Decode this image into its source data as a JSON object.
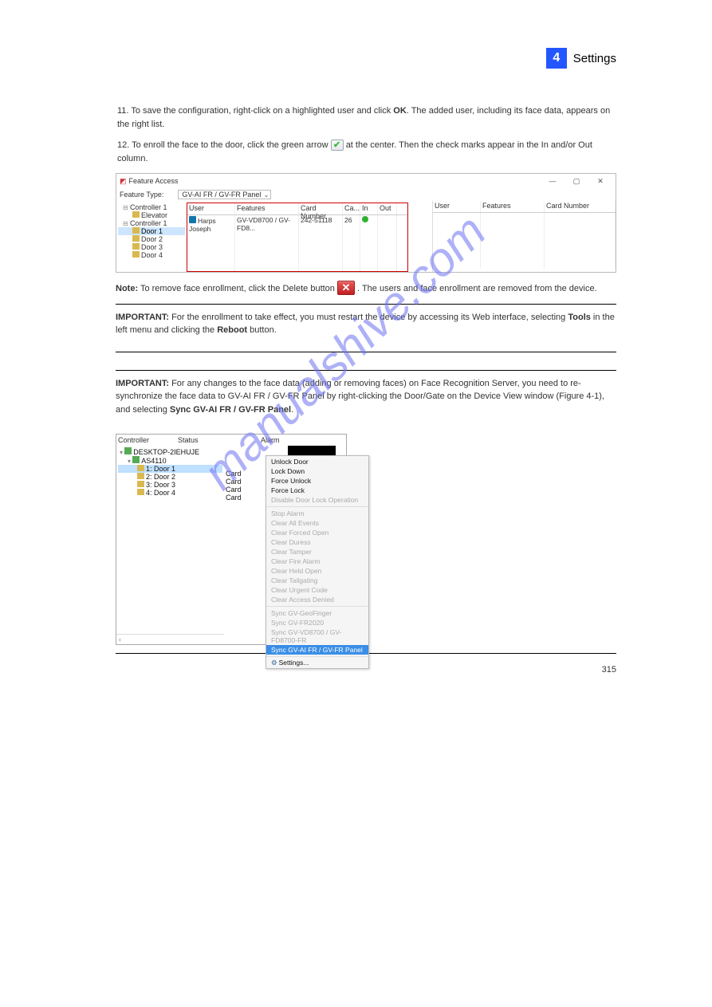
{
  "header": {
    "chapter_num": "4",
    "chapter_title": "Settings"
  },
  "step11": "11. To save the configuration, right-click on a highlighted user and click ",
  "step11_b": "OK",
  "step11_end": ". The added user, including its face data, appears on the right list.",
  "step12": "12. To enroll the face to the door, click the green arrow ",
  "step12_end": " at the center. Then the check marks appear in the In and/or Out column.",
  "note_hdr": "Note:",
  "note_txt": " To remove face enrollment, click the Delete button ",
  "note_end": ". The users and face enrollment are removed from the device.",
  "imp1_hdr": "IMPORTANT:",
  "imp1_txt": " For the enrollment to take effect, you must restart the device by accessing its Web interface, selecting ",
  "imp1_b": "Tools",
  "imp1_txt2": " in the left menu and clicking the ",
  "imp1_b2": "Reboot",
  "imp1_txt3": " button.",
  "imp2_hdr": "IMPORTANT:",
  "imp2_txt": " For any changes to the face data (adding or removing faces) on Face Recognition Server, you need to re-synchronize the face data to GV-AI FR / GV-FR Panel by right-clicking the Door/Gate on the Device View window (Figure 4-1), and selecting ",
  "imp2_b": "Sync GV-AI FR / GV-FR Panel",
  "imp2_end": ".",
  "feat_win": {
    "title": "Feature Access",
    "ft_label": "Feature Type:",
    "ft_value": "GV-AI FR / GV-FR Panel",
    "tree": {
      "c1a": "Controller 1",
      "elev": "Elevator",
      "c1b": "Controller 1",
      "d1": "Door 1",
      "d2": "Door 2",
      "d3": "Door 3",
      "d4": "Door 4"
    },
    "hdr": {
      "user": "User",
      "feat": "Features",
      "card": "Card Number",
      "ca": "Ca...",
      "in": "In",
      "out": "Out"
    },
    "row": {
      "user": "Harps Joseph",
      "feat": "GV-VD8700 / GV-FD8...",
      "card": "242-51118",
      "ca": "26"
    },
    "hdr2": {
      "user": "User",
      "feat": "Features",
      "card": "Card Number"
    }
  },
  "ctx": {
    "hdr_ctrl": "Controller",
    "hdr_status": "Status",
    "hdr_alarm": "Alarm",
    "host": "DESKTOP-2IEHUJE",
    "as": "AS4110",
    "d1": "1: Door 1",
    "d2": "2: Door 2",
    "d3": "3: Door 3",
    "d4": "4: Door 4",
    "card": "Card",
    "menu": {
      "unlock": "Unlock Door",
      "lockdown": "Lock Down",
      "forceunlock": "Force Unlock",
      "forcelock": "Force Lock",
      "disable": "Disable Door Lock Operation",
      "stopalarm": "Stop Alarm",
      "clearall": "Clear All Events",
      "clearfo": "Clear Forced Open",
      "cleardu": "Clear Duress",
      "cleartm": "Clear Tamper",
      "clearfa": "Clear Fire Alarm",
      "clearho": "Clear Held Open",
      "cleartg": "Clear Tailgating",
      "clearuc": "Clear Urgent Code",
      "clearad": "Clear Access Denied",
      "syncgf": "Sync GV-GeoFinger",
      "syncfr": "Sync GV-FR2020",
      "syncvd": "Sync GV-VD8700 / GV-FD8700-FR",
      "syncai": "Sync GV-AI FR / GV-FR Panel",
      "settings": "Settings..."
    }
  },
  "pagenum": "315"
}
